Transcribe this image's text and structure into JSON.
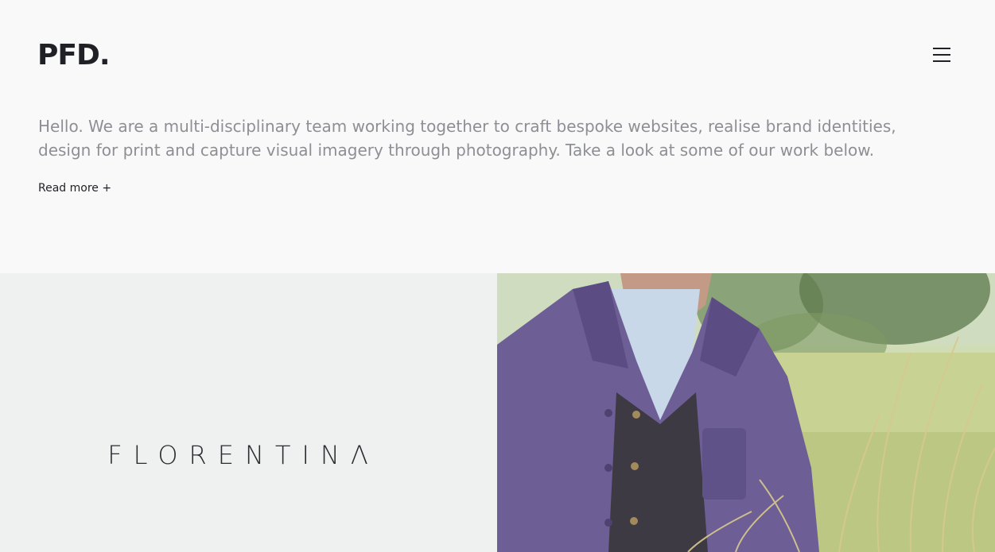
{
  "header": {
    "logo": "PFD.",
    "menu_icon": "hamburger-menu-icon"
  },
  "intro": {
    "text": "Hello. We are a multi-disciplinary team working together to craft bespoke websites, realise brand identities, design for print and capture visual imagery through photography. Take a look at some of our work below.",
    "read_more": "Read more +"
  },
  "projects": [
    {
      "title": "FLORENTINΛ"
    },
    {
      "image": "man-in-purple-jacket-in-field-photo"
    }
  ],
  "colors": {
    "background": "#f9f9f9",
    "text_dark": "#1f2126",
    "text_muted": "#8d8f94",
    "tile_grey": "#eff0f0"
  }
}
